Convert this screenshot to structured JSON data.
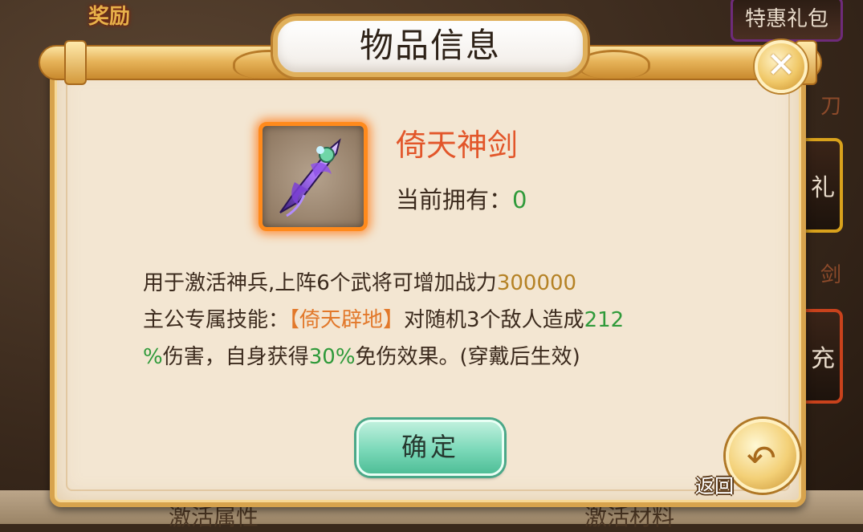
{
  "background": {
    "reward_label": "奖励",
    "side_tabs": [
      "特惠礼包"
    ],
    "side_labels": [
      "刀",
      "剑"
    ],
    "side_boxes": [
      "礼",
      "充"
    ],
    "bottom_left": "激活属性",
    "bottom_right": "激活材料"
  },
  "dialog": {
    "title": "物品信息",
    "close_icon": "close-icon",
    "item": {
      "icon": "purple-sword-icon",
      "name": "倚天神剑",
      "owned_label": "当前拥有：",
      "owned_value": "0"
    },
    "description": {
      "line1_text": "用于激活神兵,上阵6个武将可增加战力",
      "line1_power": "300000",
      "line2_prefix": "主公专属技能：",
      "skill_name": "【倚天辟地】",
      "line2_mid": "对随机3个敌人造成",
      "damage_pct_a": "212",
      "damage_pct_b": "%",
      "line3_mid": "伤害，自身获得",
      "reduction_pct": "30%",
      "line3_suffix": "免伤效果。(穿戴后生效)"
    },
    "confirm_label": "确定",
    "back_label": "返回",
    "back_icon": "return-arrow-icon"
  },
  "colors": {
    "item_name": "#e2562a",
    "green_value": "#2f9a3a",
    "gold_value": "#b58225",
    "skill": "#e2782a"
  }
}
